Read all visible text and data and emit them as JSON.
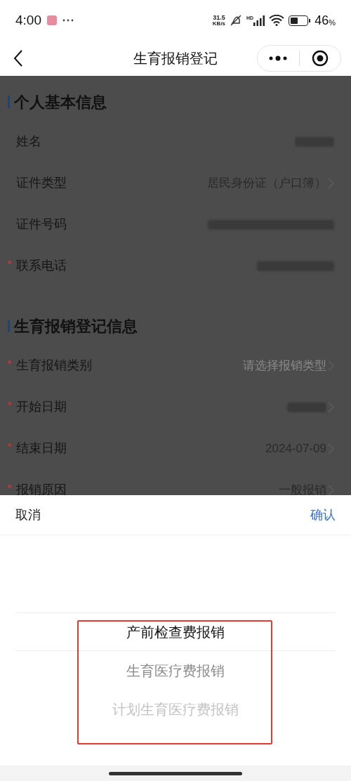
{
  "status_bar": {
    "time": "4:00",
    "speed_value": "31.5",
    "speed_unit": "KB/s",
    "network": "HD",
    "battery": "46",
    "battery_unit": "%"
  },
  "nav": {
    "title": "生育报销登记"
  },
  "sections": [
    {
      "title": "个人基本信息",
      "rows": [
        {
          "label": "姓名",
          "required": false,
          "blurred": true,
          "arrow": false
        },
        {
          "label": "证件类型",
          "required": false,
          "value": "居民身份证（户口簿）",
          "arrow": true
        },
        {
          "label": "证件号码",
          "required": false,
          "blurred": true,
          "arrow": false
        },
        {
          "label": "联系电话",
          "required": true,
          "blurred": true,
          "arrow": false
        }
      ]
    },
    {
      "title": "生育报销登记信息",
      "rows": [
        {
          "label": "生育报销类别",
          "required": true,
          "placeholder": "请选择报销类型",
          "arrow": true
        },
        {
          "label": "开始日期",
          "required": true,
          "blurred": true,
          "arrow": true
        },
        {
          "label": "结束日期",
          "required": true,
          "value": "2024-07-09",
          "arrow": true
        },
        {
          "label": "报销原因",
          "required": true,
          "value": "一般报销",
          "arrow": true
        }
      ]
    }
  ],
  "picker": {
    "cancel": "取消",
    "confirm": "确认",
    "options": [
      {
        "label": "产前检查费报销",
        "selected": true
      },
      {
        "label": "生育医疗费报销",
        "selected": false
      },
      {
        "label": "计划生育医疗费报销",
        "selected": false
      }
    ]
  }
}
